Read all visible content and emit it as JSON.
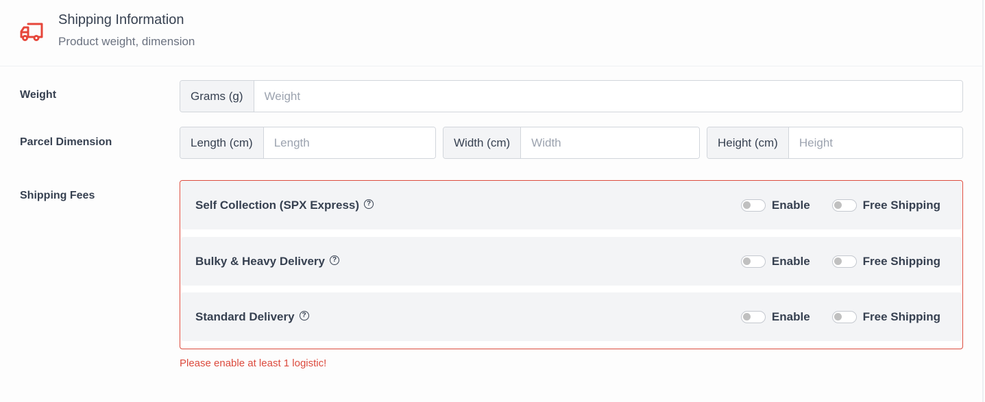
{
  "header": {
    "icon": "truck-icon",
    "title": "Shipping Information",
    "subtitle": "Product weight, dimension",
    "accent_color": "#e6463a"
  },
  "weight": {
    "label": "Weight",
    "unit": "Grams (g)",
    "value": "",
    "placeholder": "Weight"
  },
  "dimension": {
    "label": "Parcel Dimension",
    "fields": [
      {
        "unit": "Length (cm)",
        "value": "",
        "placeholder": "Length"
      },
      {
        "unit": "Width (cm)",
        "value": "",
        "placeholder": "Width"
      },
      {
        "unit": "Height (cm)",
        "value": "",
        "placeholder": "Height"
      }
    ]
  },
  "shipping_fees": {
    "label": "Shipping Fees",
    "options": [
      {
        "name": "Self Collection (SPX Express)",
        "help_icon": "question-circle-icon",
        "enable_label": "Enable",
        "enabled": false,
        "free_label": "Free Shipping",
        "free": false
      },
      {
        "name": "Bulky & Heavy Delivery",
        "help_icon": "question-circle-icon",
        "enable_label": "Enable",
        "enabled": false,
        "free_label": "Free Shipping",
        "free": false
      },
      {
        "name": "Standard Delivery",
        "help_icon": "question-circle-icon",
        "enable_label": "Enable",
        "enabled": false,
        "free_label": "Free Shipping",
        "free": false
      }
    ],
    "error_text": "Please enable at least 1 logistic!",
    "error_color": "#dc4a3d"
  },
  "help_glyph": "?"
}
